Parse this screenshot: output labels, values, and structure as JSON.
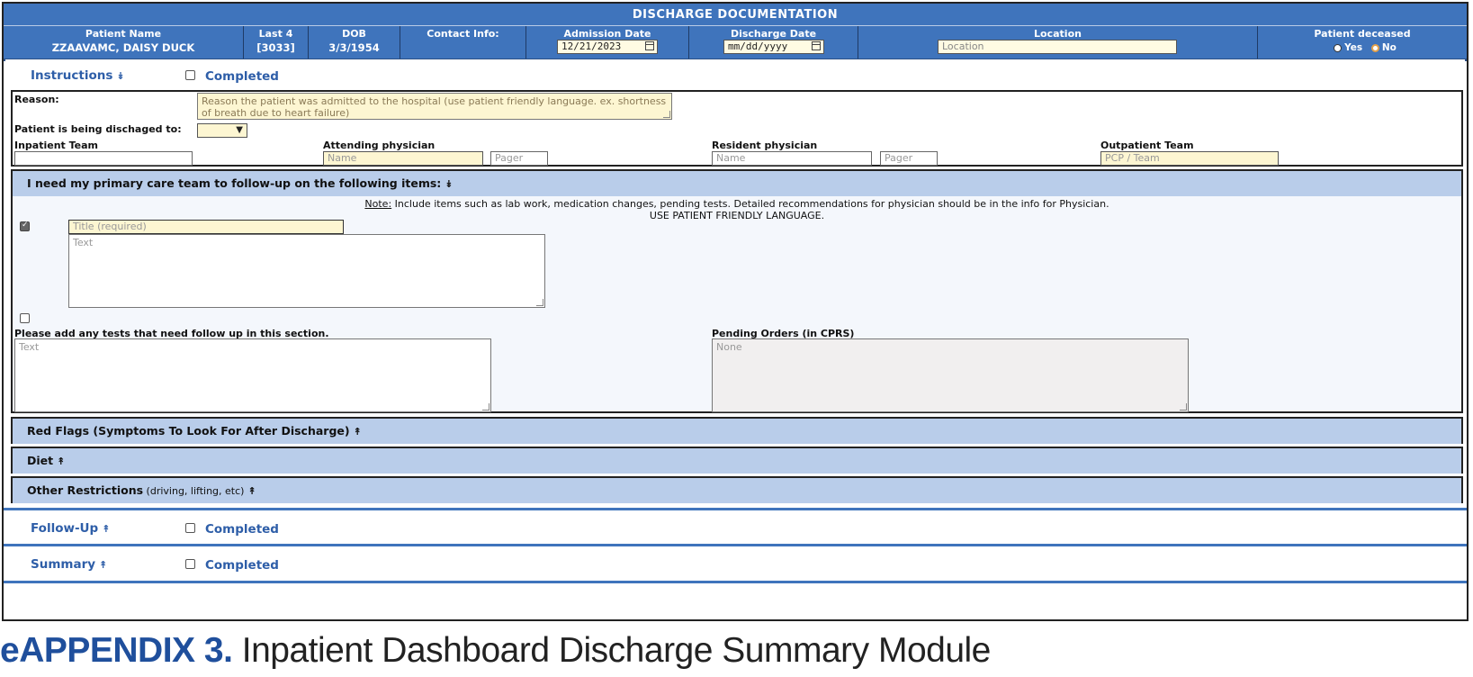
{
  "header": {
    "title": "DISCHARGE DOCUMENTATION",
    "patient_name_label": "Patient Name",
    "patient_name": "ZZAAVAMC, DAISY DUCK",
    "last4_label": "Last 4",
    "last4": "[3033]",
    "dob_label": "DOB",
    "dob": "3/3/1954",
    "contact_label": "Contact Info:",
    "admission_label": "Admission Date",
    "admission_value": "12/21/2023",
    "discharge_label": "Discharge Date",
    "discharge_placeholder": "mm/dd/yyyy",
    "location_label": "Location",
    "location_placeholder": "Location",
    "deceased_label": "Patient deceased",
    "yes_label": "Yes",
    "no_label": "No"
  },
  "instructions": {
    "title": "Instructions",
    "chevron": "»",
    "completed_label": "Completed",
    "reason_label": "Reason:",
    "reason_placeholder": "Reason the patient was admitted to the hospital (use patient friendly language. ex. shortness of breath due to heart failure)",
    "discharged_to_label": "Patient is being dischaged to:",
    "inpatient_team_label": "Inpatient Team",
    "attending_label": "Attending physician",
    "attending_name_ph": "Name",
    "attending_pager_ph": "Pager",
    "resident_label": "Resident physician",
    "resident_name_ph": "Name",
    "resident_pager_ph": "Pager",
    "outpatient_label": "Outpatient Team",
    "outpatient_ph": "PCP / Team"
  },
  "followup_items": {
    "title": "I need my primary care team to follow-up on the following items:",
    "note_prefix": "Note:",
    "note_text": " Include items such as lab work, medication changes, pending tests. Detailed recommendations for physician should be in the info for Physician.",
    "note_line2": "USE PATIENT FRIENDLY LANGUAGE.",
    "title_ph": "Title (required)",
    "text_ph": "Text",
    "tests_label": "Please add any tests that need follow up in this section.",
    "tests_ph": "Text",
    "pending_label": "Pending Orders (in CPRS)",
    "pending_value": "None"
  },
  "collapsed_sections": [
    {
      "title": "Red Flags (Symptoms To Look For After Discharge)",
      "sub": ""
    },
    {
      "title": "Diet",
      "sub": ""
    },
    {
      "title": "Other Restrictions",
      "sub": " (driving, lifting, etc)"
    }
  ],
  "lower_sections": [
    {
      "title": "Follow-Up",
      "completed_label": "Completed"
    },
    {
      "title": "Summary",
      "completed_label": "Completed"
    }
  ],
  "caption": {
    "bold": "eAPPENDIX 3.",
    "text": " Inpatient Dashboard Discharge Summary Module"
  },
  "colors": {
    "header_blue": "#3f74bc",
    "band_blue": "#b9cdea",
    "input_yellow": "#fdf6d2"
  }
}
